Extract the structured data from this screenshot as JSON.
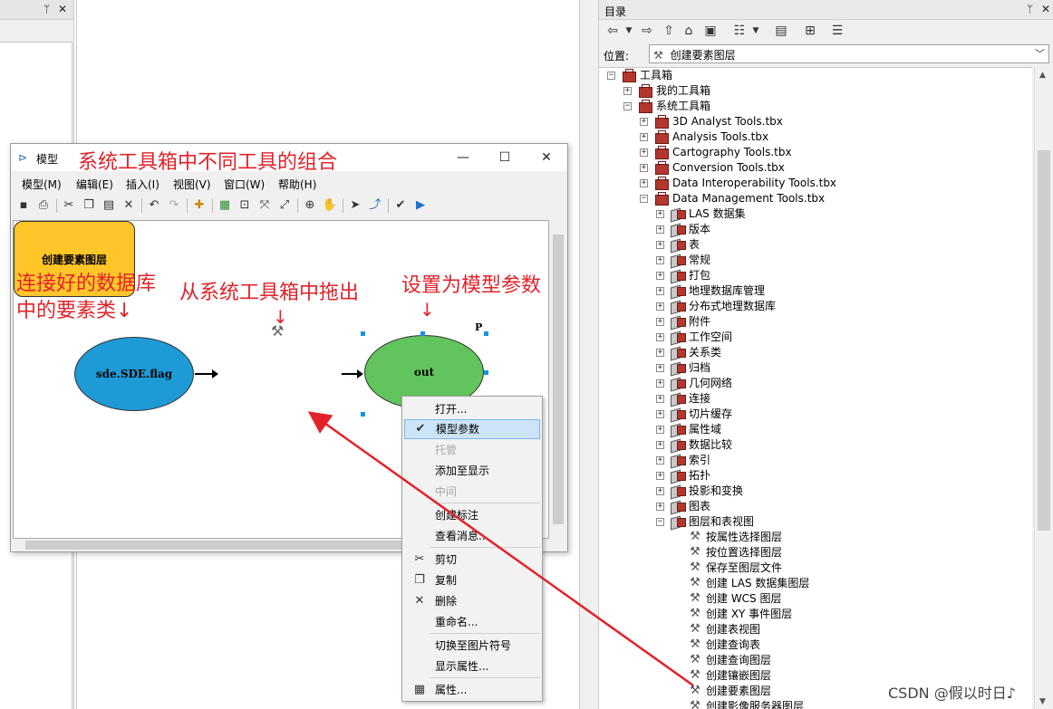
{
  "catalog": {
    "title": "目录",
    "location_label": "位置:",
    "location_value": "创建要素图层",
    "tree": [
      {
        "label": "工具箱",
        "indent": 0,
        "expander": "−",
        "icon": "toolbox-icon"
      },
      {
        "label": "我的工具箱",
        "indent": 1,
        "expander": "+",
        "icon": "toolbox-icon"
      },
      {
        "label": "系统工具箱",
        "indent": 1,
        "expander": "−",
        "icon": "toolbox-icon"
      },
      {
        "label": "3D Analyst Tools.tbx",
        "indent": 2,
        "expander": "+",
        "icon": "toolbox-icon"
      },
      {
        "label": "Analysis Tools.tbx",
        "indent": 2,
        "expander": "+",
        "icon": "toolbox-icon"
      },
      {
        "label": "Cartography Tools.tbx",
        "indent": 2,
        "expander": "+",
        "icon": "toolbox-icon"
      },
      {
        "label": "Conversion Tools.tbx",
        "indent": 2,
        "expander": "+",
        "icon": "toolbox-icon"
      },
      {
        "label": "Data Interoperability Tools.tbx",
        "indent": 2,
        "expander": "+",
        "icon": "toolbox-icon"
      },
      {
        "label": "Data Management Tools.tbx",
        "indent": 2,
        "expander": "−",
        "icon": "toolbox-icon"
      },
      {
        "label": "LAS 数据集",
        "indent": 3,
        "expander": "+",
        "icon": "toolset-icon"
      },
      {
        "label": "版本",
        "indent": 3,
        "expander": "+",
        "icon": "toolset-icon"
      },
      {
        "label": "表",
        "indent": 3,
        "expander": "+",
        "icon": "toolset-icon"
      },
      {
        "label": "常规",
        "indent": 3,
        "expander": "+",
        "icon": "toolset-icon"
      },
      {
        "label": "打包",
        "indent": 3,
        "expander": "+",
        "icon": "toolset-icon"
      },
      {
        "label": "地理数据库管理",
        "indent": 3,
        "expander": "+",
        "icon": "toolset-icon"
      },
      {
        "label": "分布式地理数据库",
        "indent": 3,
        "expander": "+",
        "icon": "toolset-icon"
      },
      {
        "label": "附件",
        "indent": 3,
        "expander": "+",
        "icon": "toolset-icon"
      },
      {
        "label": "工作空间",
        "indent": 3,
        "expander": "+",
        "icon": "toolset-icon"
      },
      {
        "label": "关系类",
        "indent": 3,
        "expander": "+",
        "icon": "toolset-icon"
      },
      {
        "label": "归档",
        "indent": 3,
        "expander": "+",
        "icon": "toolset-icon"
      },
      {
        "label": "几何网络",
        "indent": 3,
        "expander": "+",
        "icon": "toolset-icon"
      },
      {
        "label": "连接",
        "indent": 3,
        "expander": "+",
        "icon": "toolset-icon"
      },
      {
        "label": "切片缓存",
        "indent": 3,
        "expander": "+",
        "icon": "toolset-icon"
      },
      {
        "label": "属性域",
        "indent": 3,
        "expander": "+",
        "icon": "toolset-icon"
      },
      {
        "label": "数据比较",
        "indent": 3,
        "expander": "+",
        "icon": "toolset-icon"
      },
      {
        "label": "索引",
        "indent": 3,
        "expander": "+",
        "icon": "toolset-icon"
      },
      {
        "label": "拓扑",
        "indent": 3,
        "expander": "+",
        "icon": "toolset-icon"
      },
      {
        "label": "投影和变换",
        "indent": 3,
        "expander": "+",
        "icon": "toolset-icon"
      },
      {
        "label": "图表",
        "indent": 3,
        "expander": "+",
        "icon": "toolset-icon"
      },
      {
        "label": "图层和表视图",
        "indent": 3,
        "expander": "−",
        "icon": "toolset-icon"
      },
      {
        "label": "按属性选择图层",
        "indent": 4,
        "expander": "",
        "icon": "hammer-icon"
      },
      {
        "label": "按位置选择图层",
        "indent": 4,
        "expander": "",
        "icon": "hammer-icon"
      },
      {
        "label": "保存至图层文件",
        "indent": 4,
        "expander": "",
        "icon": "hammer-icon"
      },
      {
        "label": "创建 LAS 数据集图层",
        "indent": 4,
        "expander": "",
        "icon": "hammer-icon"
      },
      {
        "label": "创建 WCS 图层",
        "indent": 4,
        "expander": "",
        "icon": "hammer-icon"
      },
      {
        "label": "创建 XY 事件图层",
        "indent": 4,
        "expander": "",
        "icon": "hammer-icon"
      },
      {
        "label": "创建表视图",
        "indent": 4,
        "expander": "",
        "icon": "hammer-icon"
      },
      {
        "label": "创建查询表",
        "indent": 4,
        "expander": "",
        "icon": "hammer-icon"
      },
      {
        "label": "创建查询图层",
        "indent": 4,
        "expander": "",
        "icon": "hammer-icon"
      },
      {
        "label": "创建镶嵌图层",
        "indent": 4,
        "expander": "",
        "icon": "hammer-icon"
      },
      {
        "label": "创建要素图层",
        "indent": 4,
        "expander": "",
        "icon": "hammer-icon"
      },
      {
        "label": "创建影像服务器图层",
        "indent": 4,
        "expander": "",
        "icon": "hammer-icon"
      }
    ]
  },
  "model_window": {
    "title": "模型",
    "annotation_title": "系统工具箱中不同工具的组合",
    "menu": [
      "模型(M)",
      "编辑(E)",
      "插入(I)",
      "视图(V)",
      "窗口(W)",
      "帮助(H)"
    ],
    "nodes": {
      "input": "sde.SDE.flag",
      "tool": "创建要素图层",
      "output": "out",
      "param_marker": "P"
    },
    "annotations": {
      "left_line1": "连接好的数据库",
      "left_line2": "中的要素类↓",
      "middle": "从系统工具箱中拖出",
      "right": "设置为模型参数",
      "down_arrow": "↓"
    }
  },
  "context_menu": {
    "items": [
      {
        "label": "打开...",
        "state": "normal",
        "icon": ""
      },
      {
        "label": "模型参数",
        "state": "selected",
        "icon": "checkmark-icon"
      },
      {
        "label": "托管",
        "state": "disabled",
        "icon": ""
      },
      {
        "label": "添加至显示",
        "state": "normal",
        "icon": ""
      },
      {
        "label": "中间",
        "state": "disabled",
        "icon": ""
      },
      {
        "label": "创建标注",
        "state": "normal",
        "icon": ""
      },
      {
        "label": "查看消息...",
        "state": "normal",
        "icon": ""
      },
      {
        "label": "剪切",
        "state": "normal",
        "icon": "scissors-icon"
      },
      {
        "label": "复制",
        "state": "normal",
        "icon": "copy-icon"
      },
      {
        "label": "删除",
        "state": "normal",
        "icon": "delete-icon"
      },
      {
        "label": "重命名...",
        "state": "normal",
        "icon": ""
      },
      {
        "label": "切换至图片符号",
        "state": "normal",
        "icon": ""
      },
      {
        "label": "显示属性...",
        "state": "normal",
        "icon": ""
      },
      {
        "label": "属性...",
        "state": "normal",
        "icon": "properties-icon"
      }
    ]
  },
  "watermark": "CSDN @假以时日♪",
  "colors": {
    "input_ellipse": "#1e9ad6",
    "tool_box": "#ffc529",
    "output_ellipse": "#62c45c",
    "annotation_red": "#e0232a",
    "selection_handle": "#1793e6"
  }
}
